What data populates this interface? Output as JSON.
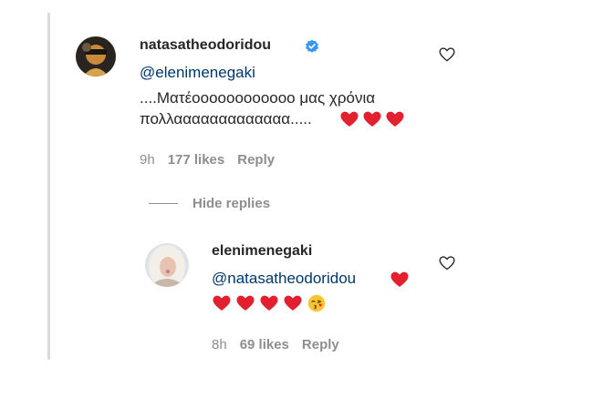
{
  "comment": {
    "username": "natasatheodoridou",
    "mention": "@elenimenegaki",
    "text_line1": "....Ματέοοοοοοοοοοοο μας χρόνια",
    "text_line2": "πολλααααααααααααα.....",
    "time": "9h",
    "likes": "177 likes",
    "reply_label": "Reply"
  },
  "hide_replies_label": "Hide replies",
  "reply_comment": {
    "username": "elenimenegaki",
    "mention": "@natasatheodoridou",
    "time": "8h",
    "likes": "69 likes",
    "reply_label": "Reply"
  },
  "colors": {
    "heart": "#e3202e",
    "verified": "#3897f0",
    "mention": "#00376b",
    "muted": "#8e8e8e"
  },
  "icons": {
    "verified": "verified-badge-icon",
    "like": "heart-outline-icon",
    "emoji_heart": "red-heart-emoji",
    "emoji_kiss": "face-blowing-kiss-emoji"
  }
}
